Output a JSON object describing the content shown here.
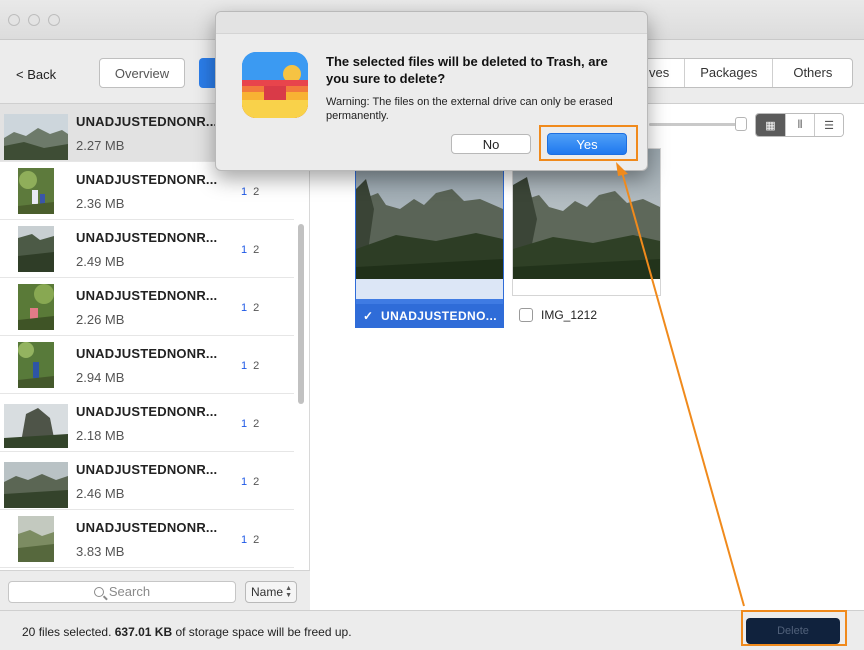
{
  "toolbar": {
    "back_label": "< Back",
    "overview_label": "Overview",
    "tabs": [
      {
        "label": "ves"
      },
      {
        "label": "Packages"
      },
      {
        "label": "Others"
      }
    ]
  },
  "file_list": [
    {
      "title": "UNADJUSTEDNONR...",
      "size": "2.27 MB",
      "badge1": "",
      "badge2": "",
      "selected": true
    },
    {
      "title": "UNADJUSTEDNONR...",
      "size": "2.36 MB",
      "badge1": "1",
      "badge2": "2"
    },
    {
      "title": "UNADJUSTEDNONR...",
      "size": "2.49 MB",
      "badge1": "1",
      "badge2": "2"
    },
    {
      "title": "UNADJUSTEDNONR...",
      "size": "2.26 MB",
      "badge1": "1",
      "badge2": "2"
    },
    {
      "title": "UNADJUSTEDNONR...",
      "size": "2.94 MB",
      "badge1": "1",
      "badge2": "2"
    },
    {
      "title": "UNADJUSTEDNONR...",
      "size": "2.18 MB",
      "badge1": "1",
      "badge2": "2"
    },
    {
      "title": "UNADJUSTEDNONR...",
      "size": "2.46 MB",
      "badge1": "1",
      "badge2": "2"
    },
    {
      "title": "UNADJUSTEDNONR...",
      "size": "3.83 MB",
      "badge1": "1",
      "badge2": "2"
    }
  ],
  "search": {
    "placeholder": "Search"
  },
  "sort": {
    "label": "Name"
  },
  "view_modes": [
    "grid-view-icon",
    "carousel-view-icon",
    "list-view-icon"
  ],
  "grid": {
    "items": [
      {
        "name": "UNADJUSTEDNO...",
        "checked": true
      },
      {
        "name": "IMG_1212",
        "checked": false
      }
    ]
  },
  "status": {
    "count": "20",
    "count_suffix": " files selected. ",
    "size": "637.01 KB",
    "size_suffix": " of storage space will be freed up."
  },
  "delete_label": "Delete",
  "dialog": {
    "title": "The selected files will be deleted to Trash, are you sure to delete?",
    "message": "Warning: The files on the external drive can only be erased permanently.",
    "no_label": "No",
    "yes_label": "Yes"
  },
  "colors": {
    "accent": "#2b7de9",
    "highlight": "#f08a1c",
    "delete_bg": "#10223d"
  }
}
